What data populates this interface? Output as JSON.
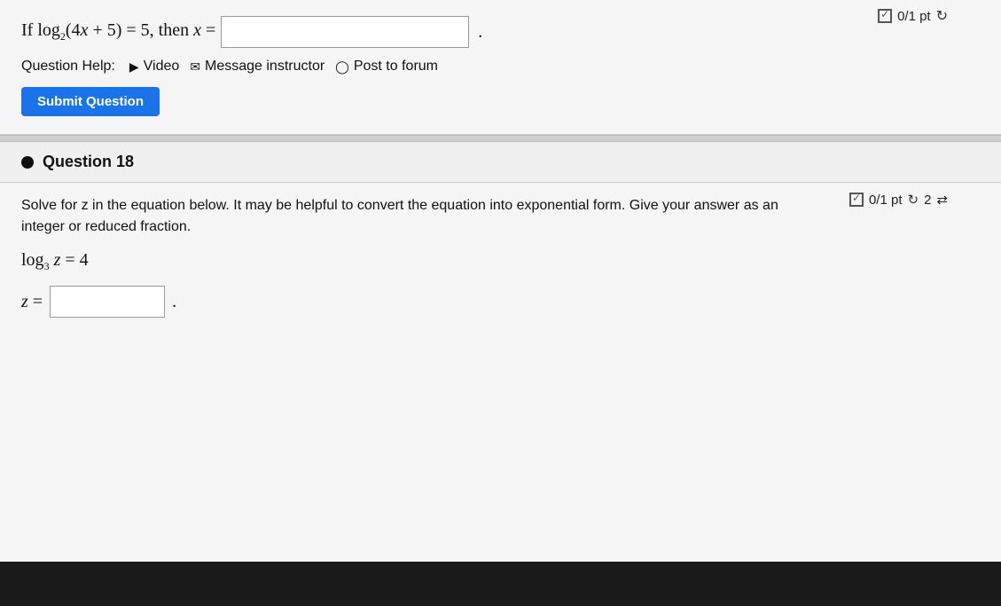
{
  "question17": {
    "score": "0/1 pt",
    "math_prefix": "If log",
    "math_base": "2",
    "math_expression": "(4x + 5) = 5, then x =",
    "answer_placeholder": "",
    "help_label": "Question Help:",
    "help_video": "Video",
    "help_message": "Message instructor",
    "help_forum": "Post to forum",
    "submit_label": "Submit Question"
  },
  "question18": {
    "number": "Question 18",
    "score": "0/1 pt",
    "attempts": "2",
    "description": "Solve for z in the equation below. It may be helpful to convert the equation into exponential form. Give your answer as an integer or reduced fraction.",
    "equation": "log₃ z = 4",
    "answer_prefix": "z =",
    "answer_placeholder": ""
  }
}
